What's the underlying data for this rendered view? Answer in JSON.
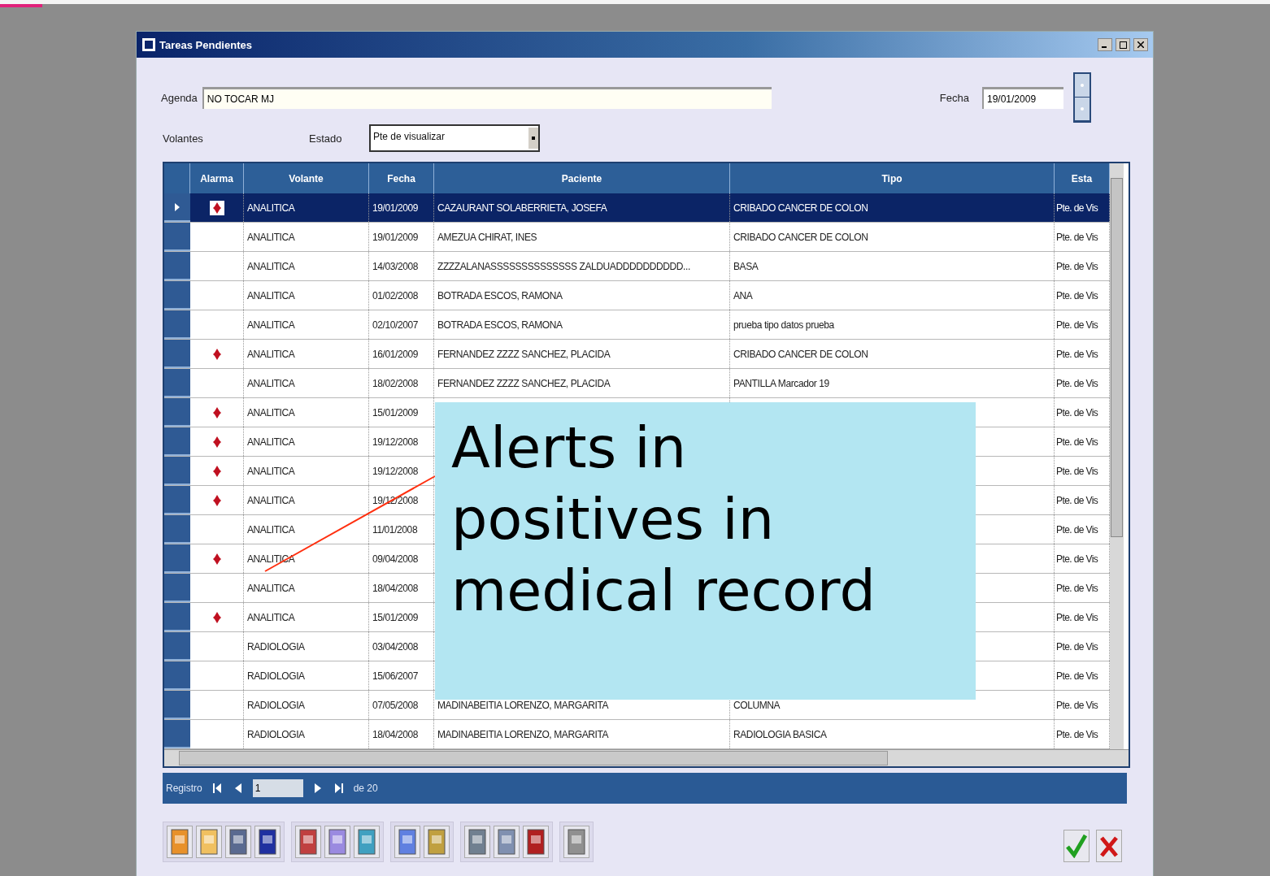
{
  "window": {
    "title": "Tareas Pendientes"
  },
  "agenda": {
    "label": "Agenda",
    "value": "NO TOCAR MJ"
  },
  "fecha": {
    "label": "Fecha",
    "value": "19/01/2009"
  },
  "volantes": {
    "label": "Volantes"
  },
  "estado": {
    "label": "Estado",
    "value": "Pte de visualizar"
  },
  "grid": {
    "columns": [
      "Alarma",
      "Volante",
      "Fecha",
      "Paciente",
      "Tipo",
      "Esta"
    ],
    "rows": [
      {
        "selected": true,
        "alarm": true,
        "volante": "ANALITICA",
        "fecha": "19/01/2009",
        "paciente": "CAZAURANT SOLABERRIETA, JOSEFA",
        "tipo": "CRIBADO CANCER DE COLON",
        "estado": "Pte. de Vis"
      },
      {
        "selected": false,
        "alarm": false,
        "volante": "ANALITICA",
        "fecha": "19/01/2009",
        "paciente": "AMEZUA CHIRAT, INES",
        "tipo": "CRIBADO CANCER DE COLON",
        "estado": "Pte. de Vis"
      },
      {
        "selected": false,
        "alarm": false,
        "volante": "ANALITICA",
        "fecha": "14/03/2008",
        "paciente": "ZZZZALANASSSSSSSSSSSSSS ZALDUADDDDDDDDDD...",
        "tipo": "BASA",
        "estado": "Pte. de Vis"
      },
      {
        "selected": false,
        "alarm": false,
        "volante": "ANALITICA",
        "fecha": "01/02/2008",
        "paciente": "BOTRADA ESCOS, RAMONA",
        "tipo": "ANA",
        "estado": "Pte. de Vis"
      },
      {
        "selected": false,
        "alarm": false,
        "volante": "ANALITICA",
        "fecha": "02/10/2007",
        "paciente": "BOTRADA ESCOS, RAMONA",
        "tipo": "prueba tipo datos prueba",
        "estado": "Pte. de Vis"
      },
      {
        "selected": false,
        "alarm": true,
        "volante": "ANALITICA",
        "fecha": "16/01/2009",
        "paciente": "FERNANDEZ ZZZZ SANCHEZ, PLACIDA",
        "tipo": "CRIBADO CANCER DE COLON",
        "estado": "Pte. de Vis"
      },
      {
        "selected": false,
        "alarm": false,
        "volante": "ANALITICA",
        "fecha": "18/02/2008",
        "paciente": "FERNANDEZ ZZZZ SANCHEZ, PLACIDA",
        "tipo": "PANTILLA Marcador 19",
        "estado": "Pte. de Vis"
      },
      {
        "selected": false,
        "alarm": true,
        "volante": "ANALITICA",
        "fecha": "15/01/2009",
        "estado": "Pte. de Vis"
      },
      {
        "selected": false,
        "alarm": true,
        "volante": "ANALITICA",
        "fecha": "19/12/2008",
        "estado": "Pte. de Vis"
      },
      {
        "selected": false,
        "alarm": true,
        "volante": "ANALITICA",
        "fecha": "19/12/2008",
        "estado": "Pte. de Vis"
      },
      {
        "selected": false,
        "alarm": true,
        "volante": "ANALITICA",
        "fecha": "19/12/2008",
        "estado": "Pte. de Vis"
      },
      {
        "selected": false,
        "alarm": false,
        "volante": "ANALITICA",
        "fecha": "11/01/2008",
        "estado": "Pte. de Vis"
      },
      {
        "selected": false,
        "alarm": true,
        "volante": "ANALITICA",
        "fecha": "09/04/2008",
        "estado": "Pte. de Vis"
      },
      {
        "selected": false,
        "alarm": false,
        "volante": "ANALITICA",
        "fecha": "18/04/2008",
        "estado": "Pte. de Vis"
      },
      {
        "selected": false,
        "alarm": true,
        "volante": "ANALITICA",
        "fecha": "15/01/2009",
        "estado": "Pte. de Vis"
      },
      {
        "selected": false,
        "alarm": false,
        "volante": "RADIOLOGIA",
        "fecha": "03/04/2008",
        "estado": "Pte. de Vis"
      },
      {
        "selected": false,
        "alarm": false,
        "volante": "RADIOLOGIA",
        "fecha": "15/06/2007",
        "estado": "Pte. de Vis"
      },
      {
        "selected": false,
        "alarm": false,
        "volante": "RADIOLOGIA",
        "fecha": "07/05/2008",
        "paciente": "MADINABEITIA LORENZO, MARGARITA",
        "tipo": "COLUMNA",
        "estado": "Pte. de Vis"
      },
      {
        "selected": false,
        "alarm": false,
        "volante": "RADIOLOGIA",
        "fecha": "18/04/2008",
        "paciente": "MADINABEITIA LORENZO, MARGARITA",
        "tipo": "RADIOLOGIA BASICA",
        "estado": "Pte. de Vis"
      }
    ]
  },
  "navigator": {
    "label": "Registro",
    "value": "1",
    "total": "de 20"
  },
  "callout": {
    "text": "Alerts in positives in medical record"
  }
}
